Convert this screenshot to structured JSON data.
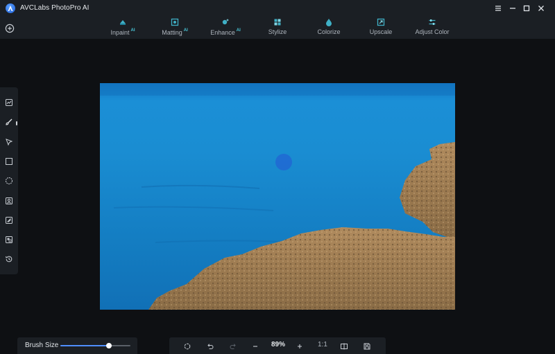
{
  "app": {
    "title": "AVCLabs PhotoPro AI"
  },
  "toolbar": {
    "tools": [
      {
        "label": "Inpaint",
        "ai": "AI",
        "icon": "inpaint-icon"
      },
      {
        "label": "Matting",
        "ai": "AI",
        "icon": "matting-icon"
      },
      {
        "label": "Enhance",
        "ai": "AI",
        "icon": "enhance-icon"
      },
      {
        "label": "Stylize",
        "ai": "",
        "icon": "stylize-icon"
      },
      {
        "label": "Colorize",
        "ai": "",
        "icon": "colorize-icon"
      },
      {
        "label": "Upscale",
        "ai": "",
        "icon": "upscale-icon"
      },
      {
        "label": "Adjust Color",
        "ai": "",
        "icon": "adjust-color-icon"
      }
    ]
  },
  "window_controls": [
    "menu-icon",
    "minimize-icon",
    "maximize-icon",
    "close-icon"
  ],
  "left_tools": [
    "image-adjust-icon",
    "brush-icon",
    "lasso-icon",
    "rectangle-select-icon",
    "ellipse-select-icon",
    "person-select-icon",
    "object-select-icon",
    "invert-select-icon",
    "history-icon"
  ],
  "brush": {
    "label": "Brush Size",
    "value_fraction": 0.69
  },
  "bottom_controls": {
    "zoom": "89%",
    "ratio": "1:1"
  },
  "colors": {
    "accent": "#4f8fff",
    "ai_badge": "#49c6d8",
    "panel": "#1b1f24",
    "background": "#0e1013"
  }
}
